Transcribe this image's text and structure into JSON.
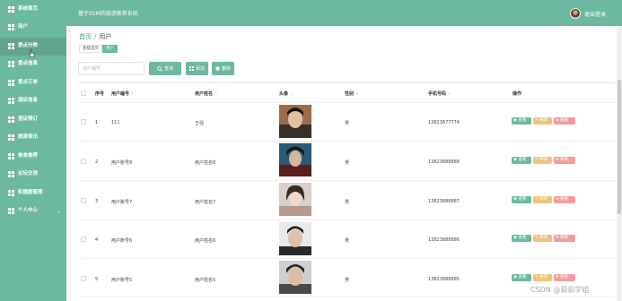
{
  "sidebar": {
    "items": [
      {
        "label": "系统首页"
      },
      {
        "label": "用户"
      },
      {
        "label": "景点分类"
      },
      {
        "label": "景点信息"
      },
      {
        "label": "景点订单"
      },
      {
        "label": "酒店信息"
      },
      {
        "label": "酒店预订"
      },
      {
        "label": "旅游资讯"
      },
      {
        "label": "美食推荐"
      },
      {
        "label": "论坛交流"
      },
      {
        "label": "轮播图管理"
      },
      {
        "label": "个人中心"
      }
    ],
    "expand_arrow": "⌄"
  },
  "header": {
    "title": "基于SSM的旅游推荐系统",
    "logout": "退出登录"
  },
  "breadcrumb": {
    "home": "首页",
    "separator": "/",
    "current": "用户"
  },
  "tabs": [
    {
      "label": "系统首页"
    },
    {
      "label": "用户"
    }
  ],
  "search": {
    "placeholder": "用户编号",
    "search_label": "查询",
    "add_label": "添加",
    "delete_label": "删除"
  },
  "table": {
    "columns": [
      "序号",
      "用户编号",
      "用户姓名",
      "头像",
      "性别",
      "手机号码",
      "操作"
    ],
    "rows": [
      {
        "index": "1",
        "user_no": "111",
        "name": "王强",
        "gender": "男",
        "phone": "13823877774"
      },
      {
        "index": "2",
        "user_no": "用户账号8",
        "name": "用户姓名8",
        "gender": "男",
        "phone": "13823888888"
      },
      {
        "index": "3",
        "user_no": "用户账号7",
        "name": "用户姓名7",
        "gender": "男",
        "phone": "13823888887"
      },
      {
        "index": "4",
        "user_no": "用户账号6",
        "name": "用户姓名6",
        "gender": "男",
        "phone": "13823888886"
      },
      {
        "index": "5",
        "user_no": "用户账号5",
        "name": "用户姓名5",
        "gender": "男",
        "phone": "13823888885"
      }
    ],
    "actions": {
      "view": "查看",
      "edit": "修改",
      "delete": "删除"
    }
  },
  "watermark": "CSDN @茹茹学姐",
  "colors": {
    "accent": "#6cb8a0",
    "edit": "#f0c27a",
    "delete": "#f29b9b"
  }
}
